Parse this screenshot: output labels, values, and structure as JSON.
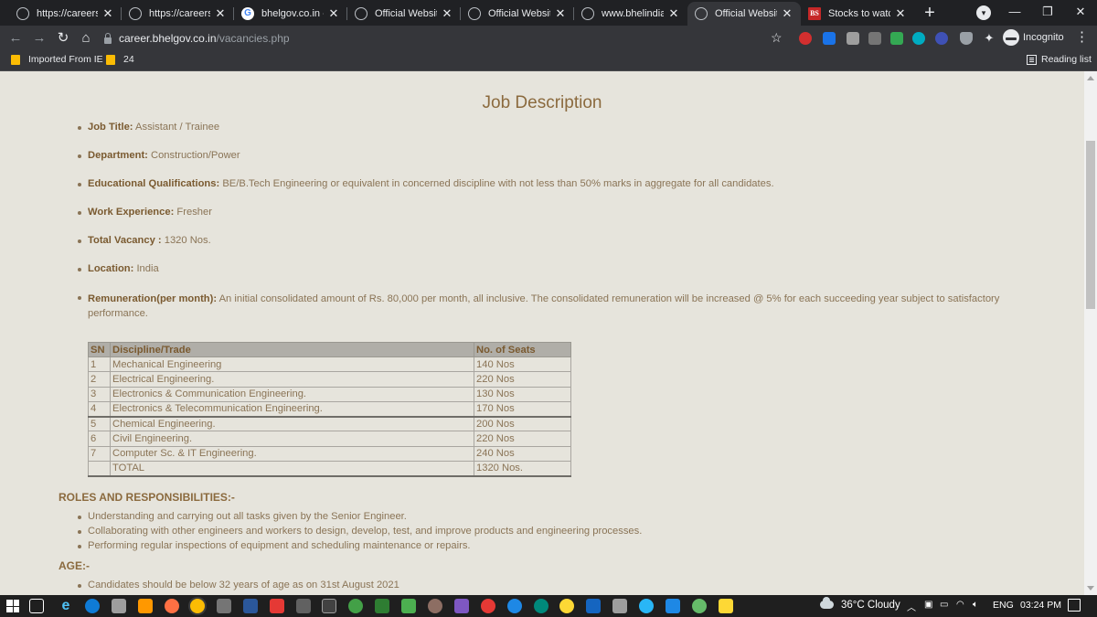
{
  "browser": {
    "tabs": [
      {
        "title": "https://careers.bh",
        "icon": "globe-icon"
      },
      {
        "title": "https://careers.bh",
        "icon": "globe-icon"
      },
      {
        "title": "bhelgov.co.in - Go",
        "icon": "google-icon"
      },
      {
        "title": "Official Website o",
        "icon": "globe-icon"
      },
      {
        "title": "Official Website o",
        "icon": "globe-icon"
      },
      {
        "title": "www.bhelindia.in",
        "icon": "globe-icon"
      },
      {
        "title": "Official Website o",
        "icon": "globe-icon",
        "active": true
      },
      {
        "title": "Stocks to watch: C",
        "icon": "bs-icon"
      }
    ],
    "url_host": "career.bhelgov.co.in",
    "url_path": "/vacancies.php",
    "profile_label": "Incognito",
    "bookmarks": [
      {
        "label": "Imported From IE"
      },
      {
        "label": "24"
      }
    ],
    "reading_list_label": "Reading list"
  },
  "page": {
    "title": "Job Description",
    "fields": [
      {
        "label": "Job Title:",
        "value": " Assistant / Trainee"
      },
      {
        "label": "Department:",
        "value": " Construction/Power"
      },
      {
        "label": "Educational Qualifications:",
        "value": " BE/B.Tech Engineering or equivalent in concerned discipline with not less than 50% marks in aggregate for all candidates."
      },
      {
        "label": "Work Experience:",
        "value": " Fresher"
      },
      {
        "label": "Total Vacancy :",
        "value": " 1320 Nos."
      },
      {
        "label": "Location:",
        "value": " India"
      },
      {
        "label": "Remuneration(per month):",
        "value": " An initial consolidated amount of Rs. 80,000 per month, all inclusive. The consolidated remuneration will be increased @ 5% for each succeeding year subject to satisfactory performance."
      }
    ],
    "table": {
      "headers": [
        "SN",
        "Discipline/Trade",
        "No. of Seats"
      ],
      "rows": [
        [
          "1",
          "Mechanical Engineering",
          "140 Nos"
        ],
        [
          "2",
          "Electrical Engineering.",
          "220 Nos"
        ],
        [
          "3",
          "Electronics & Communication Engineering.",
          "130 Nos"
        ],
        [
          "4",
          "Electronics & Telecommunication Engineering.",
          "170 Nos"
        ],
        [
          "5",
          "Chemical Engineering.",
          "200 Nos"
        ],
        [
          "6",
          "Civil Engineering.",
          "220 Nos"
        ],
        [
          "7",
          "Computer Sc. & IT Engineering.",
          "240 Nos"
        ],
        [
          "",
          "TOTAL",
          "1320 Nos."
        ]
      ]
    },
    "roles_heading": "ROLES AND RESPONSIBILITIES:-",
    "roles": [
      "Understanding and carrying out all tasks given by the Senior Engineer.",
      "Collaborating with other engineers and workers to design, develop, test, and improve products and engineering processes.",
      "Performing regular inspections of equipment and scheduling maintenance or repairs."
    ],
    "age_heading": "AGE:-",
    "age_items": [
      "Candidates should be below 32 years of age as on 31st August 2021"
    ]
  },
  "taskbar": {
    "weather": "36°C  Cloudy",
    "language": "ENG",
    "time": "03:24 PM"
  }
}
